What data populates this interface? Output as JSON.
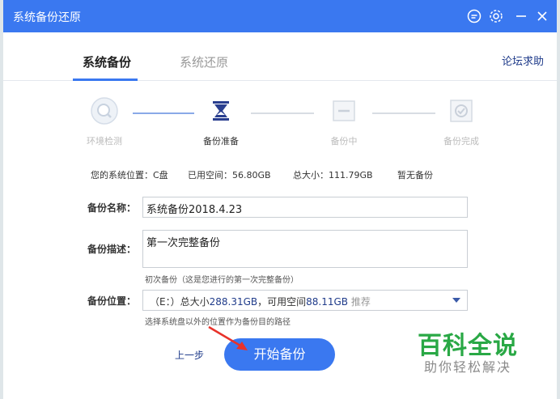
{
  "window": {
    "title": "系统备份还原",
    "accent": "#3a78f0"
  },
  "tabs": [
    {
      "label": "系统备份",
      "active": true
    },
    {
      "label": "系统还原",
      "active": false
    }
  ],
  "help_link": "论坛求助",
  "steps": [
    {
      "label": "环境检测",
      "icon": "magnifier-icon",
      "state": "done"
    },
    {
      "label": "备份准备",
      "icon": "hourglass-icon",
      "state": "current"
    },
    {
      "label": "备份中",
      "icon": "progress-icon",
      "state": "pending"
    },
    {
      "label": "备份完成",
      "icon": "check-icon",
      "state": "pending"
    }
  ],
  "system_info": {
    "location": "您的系统位置：C盘",
    "used_space": "已用空间：56.80GB",
    "total_size": "总大小：111.79GB",
    "backup_status": "暂无备份"
  },
  "form": {
    "name_label": "备份名称：",
    "name_value": "系统备份2018.4.23",
    "desc_label": "备份描述：",
    "desc_value": "第一次完整备份",
    "desc_hint": "初次备份（这是您进行的第一次完整备份）",
    "location_label": "备份位置：",
    "location_drive": "（E：）总大小",
    "location_total": "288.31GB",
    "location_avail_label": "，可用空间",
    "location_avail": "88.11GB",
    "location_recommend": " 推荐",
    "location_hint": "选择系统盘以外的位置作为备份目的路径"
  },
  "buttons": {
    "prev": "上一步",
    "start": "开始备份"
  },
  "watermark": {
    "main": "百科全说",
    "sub": "助你轻松解决"
  }
}
